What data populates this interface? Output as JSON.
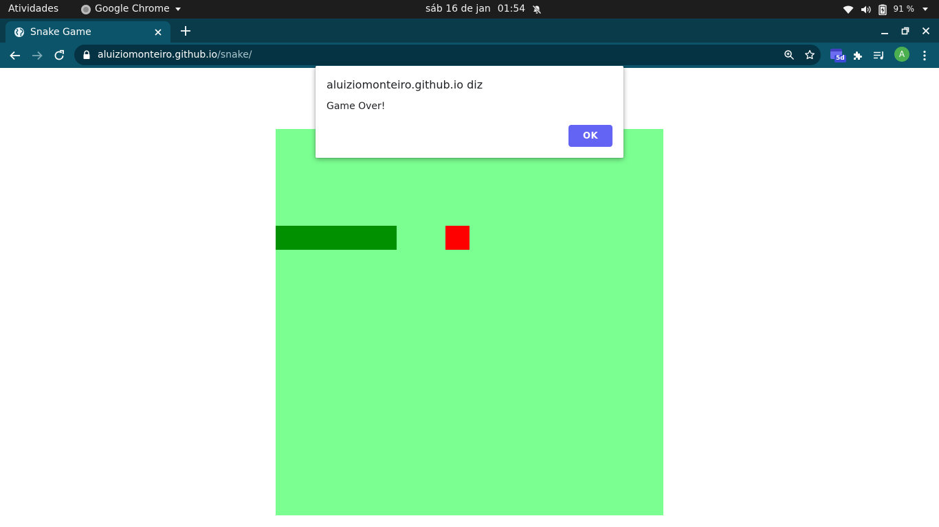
{
  "system_bar": {
    "activities": "Atividades",
    "app_name": "Google Chrome",
    "date": "sáb 16 de jan",
    "time": "01:54",
    "battery_percent": "91 %"
  },
  "browser": {
    "tab": {
      "title": "Snake Game"
    },
    "url": {
      "host": "aluiziomonteiro.github.io",
      "path": "/snake/"
    },
    "extension_badge": "5d",
    "profile_initial": "A"
  },
  "alert": {
    "title": "aluiziomonteiro.github.io diz",
    "message": "Game Over!",
    "ok_label": "OK"
  },
  "game": {
    "board_color": "#7bff91",
    "snake_color": "#009000",
    "food_color": "#ff0000"
  },
  "colors": {
    "chrome_tab_active": "#0c5469",
    "chrome_frame": "#0a3b4b",
    "alert_button": "#6464f4"
  }
}
